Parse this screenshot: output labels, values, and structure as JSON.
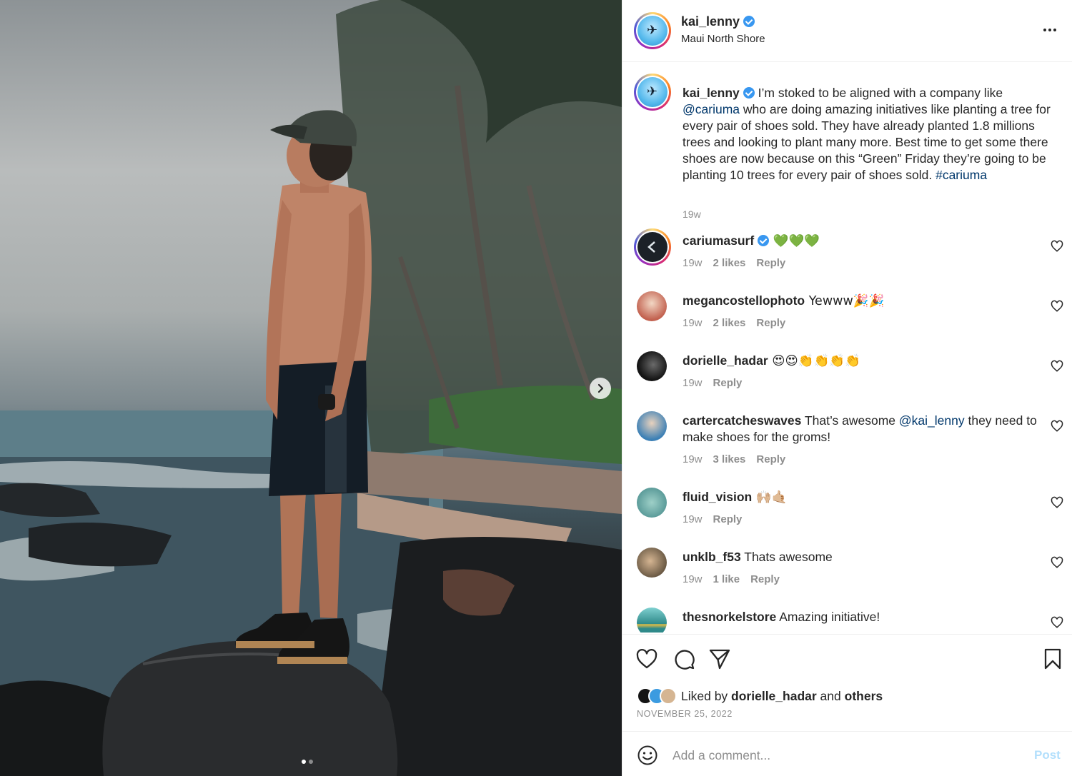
{
  "post": {
    "username": "kai_lenny",
    "location": "Maui North Shore",
    "caption_pre": "I’m stoked to be aligned with a company like ",
    "caption_mention": "@cariuma",
    "caption_mid": " who are doing amazing initiatives like planting a tree for every pair of shoes sold. They have already planted 1.8 millions trees and looking to plant many more. Best time to get some there shoes are now because on this “Green” Friday they’re going to be planting 10 trees for every pair of shoes sold. ",
    "caption_hashtag": "#cariuma",
    "caption_time": "19w",
    "liked_by_prefix": "Liked by ",
    "liked_by_user": "dorielle_hadar",
    "liked_by_and": " and ",
    "liked_by_others": "others",
    "date": "NOVEMBER 25, 2022"
  },
  "comments": [
    {
      "user": "cariumasurf",
      "text": " 💚💚💚",
      "time": "19w",
      "likes": "2 likes",
      "reply": "Reply",
      "avatar_color": "#1c2127"
    },
    {
      "user": "megancostellophoto",
      "text": " Yewww🎉🎉",
      "time": "19w",
      "likes": "2 likes",
      "reply": "Reply",
      "avatar_color": "#c2614f"
    },
    {
      "user": "dorielle_hadar",
      "text": " 😍😍👏👏👏👏",
      "time": "19w",
      "likes": "",
      "reply": "Reply",
      "avatar_color": "#141414"
    },
    {
      "user": "cartercatcheswaves",
      "text_pre": " That’s awesome ",
      "mention": "@kai_lenny",
      "text_post": " they need to make shoes for the groms!",
      "time": "19w",
      "likes": "3 likes",
      "reply": "Reply",
      "avatar_color": "#3b7fb5"
    },
    {
      "user": "fluid_vision",
      "text": " 🙌🏼🤙🏼",
      "time": "19w",
      "likes": "",
      "reply": "Reply",
      "avatar_color": "#5c9c9a"
    },
    {
      "user": "unklb_f53",
      "text": " Thats awesome",
      "time": "19w",
      "likes": "1 like",
      "reply": "Reply",
      "avatar_color": "#6b5a45"
    },
    {
      "user": "thesnorkelstore",
      "text": " Amazing initiative!",
      "time": "",
      "likes": "",
      "reply": "",
      "avatar_color": "#2f8a8a"
    }
  ],
  "add_comment": {
    "placeholder": "Add a comment...",
    "post_label": "Post"
  },
  "carousel": {
    "count": 2,
    "active": 1
  },
  "colors": {
    "link": "#00376b",
    "verified": "#3897f0",
    "muted": "#8e8e8e",
    "post_disabled": "#b2dffc"
  }
}
